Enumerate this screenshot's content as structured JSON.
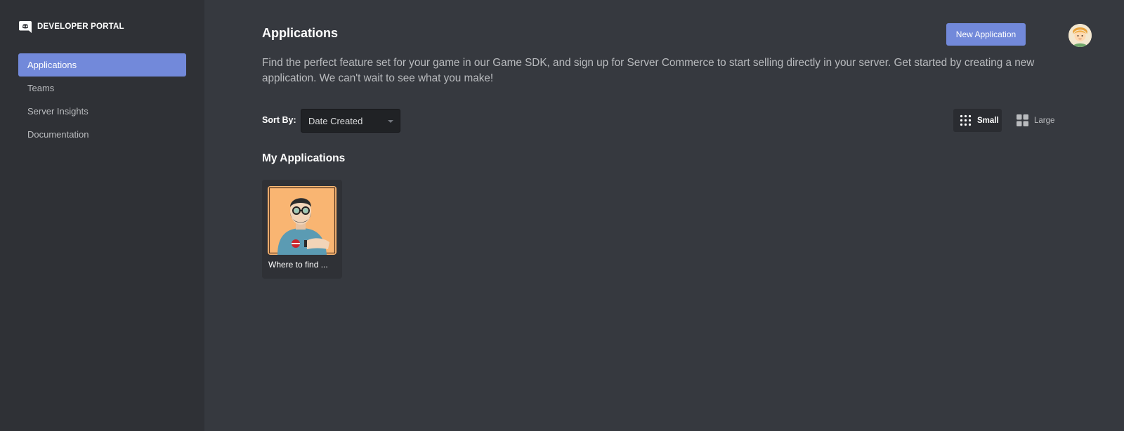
{
  "sidebar": {
    "brand_title": "DEVELOPER PORTAL",
    "brand_icon": "discord-logo-icon",
    "items": [
      {
        "label": "Applications",
        "active": true
      },
      {
        "label": "Teams",
        "active": false
      },
      {
        "label": "Server Insights",
        "active": false
      },
      {
        "label": "Documentation",
        "active": false
      }
    ]
  },
  "header": {
    "title": "Applications",
    "new_button_label": "New Application",
    "avatar_icon": "user-avatar-icon"
  },
  "description": "Find the perfect feature set for your game in our Game SDK, and sign up for Server Commerce to start selling directly in your server. Get started by creating a new application. We can't wait to see what you make!",
  "sort": {
    "label": "Sort By:",
    "selected": "Date Created"
  },
  "view_toggle": {
    "small_label": "Small",
    "large_label": "Large",
    "selected": "Small"
  },
  "my_apps": {
    "title": "My Applications",
    "apps": [
      {
        "name": "Where to find ...",
        "icon": "bearded-man-avatar-icon"
      }
    ]
  },
  "colors": {
    "accent": "#7289da",
    "sidebar_bg": "#2f3136",
    "main_bg": "#36393f",
    "app_icon_bg": "#f9b572"
  }
}
